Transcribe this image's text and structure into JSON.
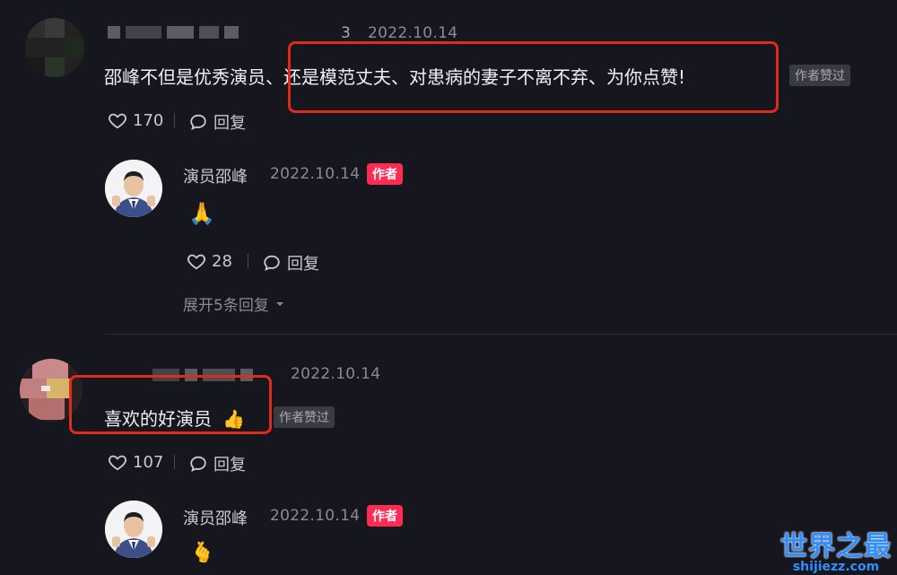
{
  "comments": [
    {
      "date": "2022.10.14",
      "suffix": "3",
      "text": "邵峰不但是优秀演员、还是模范丈夫、对患病的妻子不离不弃、为你点赞!",
      "tag": "作者赞过",
      "likes": "170",
      "reply_label": "回复",
      "replies": [
        {
          "name": "演员邵峰",
          "date": "2022.10.14",
          "tag": "作者",
          "emoji": "🙏",
          "likes": "28",
          "reply_label": "回复",
          "expand": "展开5条回复"
        }
      ]
    },
    {
      "date": "2022.10.14",
      "text": "喜欢的好演员",
      "emoji": "👍",
      "tag": "作者赞过",
      "likes": "107",
      "reply_label": "回复",
      "replies": [
        {
          "name": "演员邵峰",
          "date": "2022.10.14",
          "tag": "作者",
          "emoji": "🫰"
        }
      ]
    }
  ],
  "watermark": {
    "title": "世界之最",
    "url": "shijiezz.com"
  },
  "colors": {
    "background": "#16161f",
    "highlight_box": "#e02a1a",
    "author_tag": "#fe2c55",
    "watermark": "#2f8fff"
  }
}
